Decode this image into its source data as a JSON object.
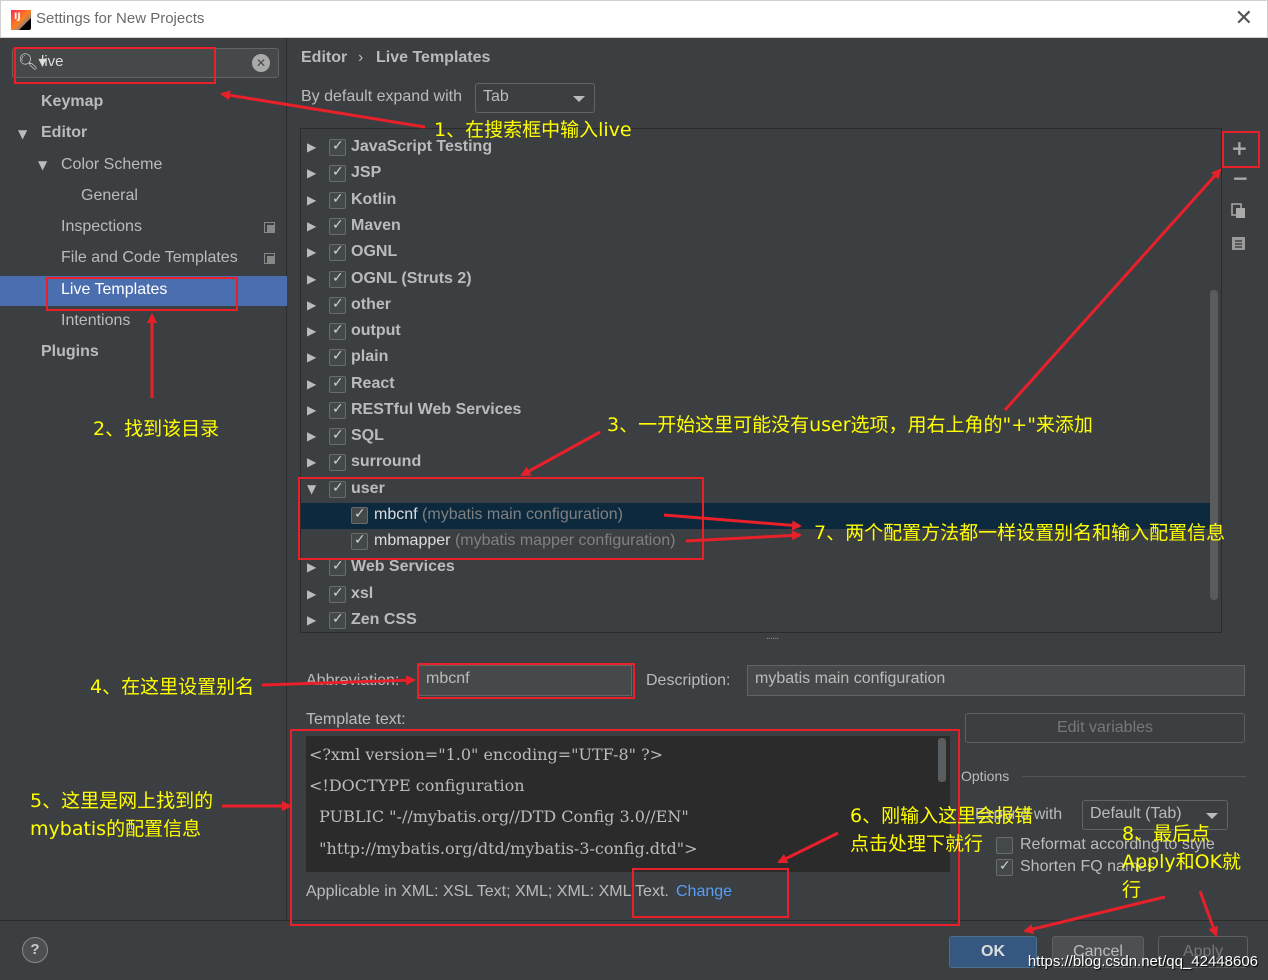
{
  "window": {
    "title": "Settings for New Projects",
    "close": "✕"
  },
  "search": {
    "value": "live",
    "clear": "✕"
  },
  "sidebar": {
    "items": [
      {
        "label": "Keymap"
      },
      {
        "label": "Editor"
      },
      {
        "label": "Color Scheme"
      },
      {
        "label": "General"
      },
      {
        "label": "Inspections"
      },
      {
        "label": "File and Code Templates"
      },
      {
        "label": "Live Templates"
      },
      {
        "label": "Intentions"
      },
      {
        "label": "Plugins"
      }
    ],
    "selected": "Live Templates"
  },
  "breadcrumb": {
    "parent": "Editor",
    "separator": "›",
    "current": "Live Templates"
  },
  "expand": {
    "label": "By default expand with",
    "value": "Tab"
  },
  "templates": {
    "groups": [
      {
        "name": "JavaScript Testing",
        "checked": true,
        "expanded": false
      },
      {
        "name": "JSP",
        "checked": true,
        "expanded": false
      },
      {
        "name": "Kotlin",
        "checked": true,
        "expanded": false
      },
      {
        "name": "Maven",
        "checked": true,
        "expanded": false
      },
      {
        "name": "OGNL",
        "checked": true,
        "expanded": false
      },
      {
        "name": "OGNL (Struts 2)",
        "checked": true,
        "expanded": false
      },
      {
        "name": "other",
        "checked": true,
        "expanded": false
      },
      {
        "name": "output",
        "checked": true,
        "expanded": false
      },
      {
        "name": "plain",
        "checked": true,
        "expanded": false
      },
      {
        "name": "React",
        "checked": true,
        "expanded": false
      },
      {
        "name": "RESTful Web Services",
        "checked": true,
        "expanded": false
      },
      {
        "name": "SQL",
        "checked": true,
        "expanded": false
      },
      {
        "name": "surround",
        "checked": true,
        "expanded": false
      },
      {
        "name": "user",
        "checked": true,
        "expanded": true
      },
      {
        "name": "Web Services",
        "checked": true,
        "expanded": false
      },
      {
        "name": "xsl",
        "checked": true,
        "expanded": false
      },
      {
        "name": "Zen CSS",
        "checked": true,
        "expanded": false
      }
    ],
    "user_children": [
      {
        "abbr": "mbcnf",
        "desc": "(mybatis main configuration)",
        "checked": true
      },
      {
        "abbr": "mbmapper",
        "desc": "(mybatis mapper configuration)",
        "checked": true
      }
    ],
    "toolbar": {
      "add": "+",
      "remove": "−",
      "copy_icon": "copy-icon",
      "group_icon": "group-icon"
    }
  },
  "splitter": "......",
  "form": {
    "abbreviation_label": "Abbreviation:",
    "abbreviation_value": "mbcnf",
    "description_label": "Description:",
    "description_value": "mybatis main configuration",
    "template_text_label": "Template text:",
    "template_lines": [
      "<?xml version=\"1.0\" encoding=\"UTF-8\" ?>",
      "<!DOCTYPE configuration",
      "  PUBLIC \"-//mybatis.org//DTD Config 3.0//EN\"",
      "  \"http://mybatis.org/dtd/mybatis-3-config.dtd\">"
    ],
    "applicable_prefix": "Applicable in XML: XSL Text; XML; XML: XML Text.",
    "applicable_change": "Change",
    "edit_variables": "Edit variables",
    "options_label": "Options",
    "expand_with_label": "Expand with",
    "expand_with_value": "Default (Tab)",
    "reformat_label": "Reformat according to style",
    "shorten_label": "Shorten FQ names",
    "reformat_checked": false,
    "shorten_checked": true
  },
  "footer": {
    "help": "?",
    "ok": "OK",
    "cancel": "Cancel",
    "apply": "Apply"
  },
  "annotations": {
    "a1": "1、在搜索框中输入live",
    "a2": "2、找到该目录",
    "a3": "3、一开始这里可能没有user选项，用右上角的\"+\"来添加",
    "a4": "4、在这里设置别名",
    "a5_line1": "5、这里是网上找到的",
    "a5_line2": "mybatis的配置信息",
    "a6_line1": "6、刚输入这里会报错",
    "a6_line2": "点击处理下就行",
    "a7": "7、两个配置方法都一样设置别名和输入配置信息",
    "a8_line1": "8、最后点",
    "a8_line2": "Apply和OK就",
    "a8_line3": "行"
  },
  "watermark": "https://blog.csdn.net/qq_42448606",
  "colors": {
    "annotation": "#ffff00",
    "highlight_box": "#e8202a",
    "selection": "#4b6eaf"
  }
}
